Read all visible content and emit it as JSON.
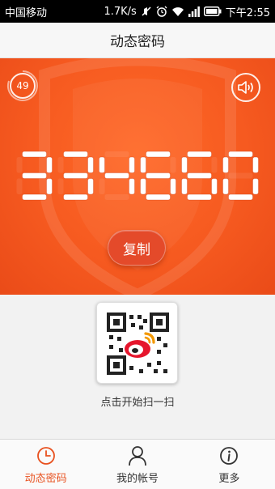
{
  "status_bar": {
    "carrier": "中国移动",
    "net_speed": "1.7K/s",
    "time": "下午2:55"
  },
  "header": {
    "title": "动态密码"
  },
  "token": {
    "countdown": "49",
    "code": "334660",
    "copy_label": "复制"
  },
  "qr": {
    "hint": "点击开始扫一扫"
  },
  "tabs": [
    {
      "label": "动态密码",
      "icon": "clock-icon",
      "active": true
    },
    {
      "label": "我的帐号",
      "icon": "user-icon",
      "active": false
    },
    {
      "label": "更多",
      "icon": "info-icon",
      "active": false
    }
  ],
  "colors": {
    "accent": "#e8511f",
    "hero_bg": "#f65a20"
  }
}
